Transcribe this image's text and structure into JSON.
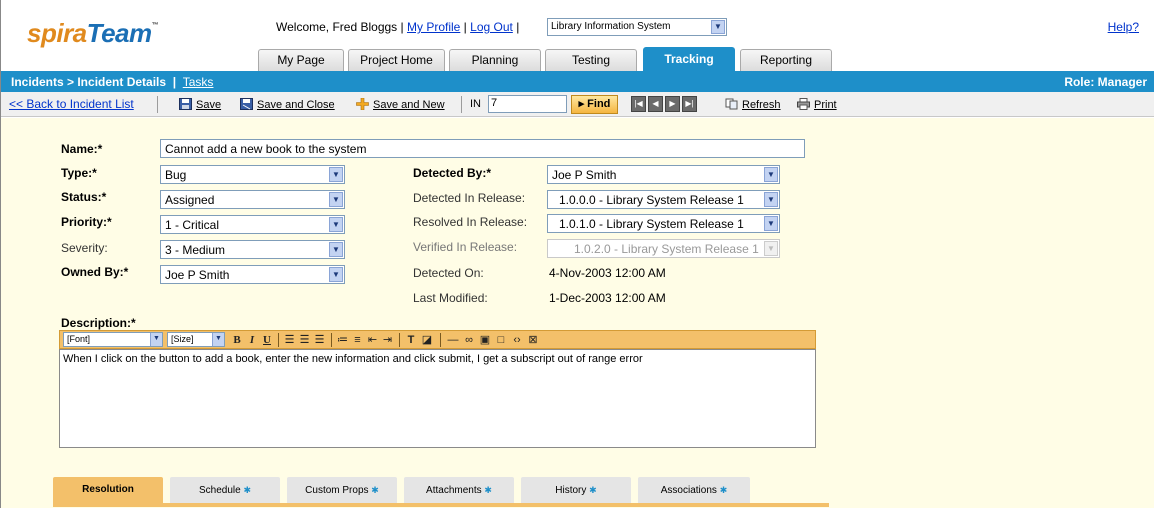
{
  "header": {
    "logo_spira": "spira",
    "logo_team": "Team",
    "logo_tm": "™",
    "welcome_text": "Welcome, Fred Bloggs",
    "sep1": "|",
    "my_profile": "My Profile",
    "sep2": "|",
    "log_out": "Log Out",
    "sep3": "|",
    "project_select": "Library Information System",
    "help": "Help?"
  },
  "tabs": [
    {
      "label": "My Page"
    },
    {
      "label": "Project Home"
    },
    {
      "label": "Planning"
    },
    {
      "label": "Testing"
    },
    {
      "label": "Tracking",
      "active": true
    },
    {
      "label": "Reporting"
    }
  ],
  "bluebar": {
    "breadcrumb": "Incidents > Incident Details",
    "divider": "|",
    "tasks": "Tasks",
    "role": "Role: Manager"
  },
  "toolbar": {
    "back": "<< Back to Incident List",
    "save": "Save",
    "save_close": "Save and Close",
    "save_new": "Save and New",
    "in_label": "IN",
    "in_value": "7",
    "find": "▸ Find",
    "refresh": "Refresh",
    "print": "Print"
  },
  "form": {
    "name_label": "Name:*",
    "name_value": "Cannot add a new book to the system",
    "type_label": "Type:*",
    "type_value": "Bug",
    "status_label": "Status:*",
    "status_value": "Assigned",
    "priority_label": "Priority:*",
    "priority_value": "1 - Critical",
    "severity_label": "Severity:",
    "severity_value": "3 - Medium",
    "owned_label": "Owned By:*",
    "owned_value": "Joe P Smith",
    "detected_by_label": "Detected By:*",
    "detected_by_value": "Joe P Smith",
    "detected_release_label": "Detected In Release:",
    "detected_release_value": "1.0.0.0 - Library System Release 1",
    "resolved_release_label": "Resolved In Release:",
    "resolved_release_value": "1.0.1.0 - Library System Release 1",
    "verified_release_label": "Verified In Release:",
    "verified_release_value": "1.0.2.0 - Library System Release 1",
    "detected_on_label": "Detected On:",
    "detected_on_value": "4-Nov-2003 12:00 AM",
    "last_modified_label": "Last Modified:",
    "last_modified_value": "1-Dec-2003 12:00 AM",
    "description_label": "Description:*",
    "description_value": "When I click on the button to add a book, enter the new information and click submit, I get a subscript out of range error"
  },
  "editor": {
    "font": "[Font]",
    "size": "[Size]",
    "bold": "B",
    "italic": "I",
    "underline": "U"
  },
  "bottom_tabs": [
    {
      "label": "Resolution",
      "active": true,
      "star": ""
    },
    {
      "label": "Schedule",
      "star": "✱"
    },
    {
      "label": "Custom Props",
      "star": "✱"
    },
    {
      "label": "Attachments",
      "star": "✱"
    },
    {
      "label": "History",
      "star": "✱"
    },
    {
      "label": "Associations",
      "star": "✱"
    }
  ],
  "colors": {
    "brand_blue": "#1e8fc9",
    "brand_orange": "#e08a1e",
    "content_bg": "#fffde6",
    "editor_bar": "#f3c06a"
  }
}
